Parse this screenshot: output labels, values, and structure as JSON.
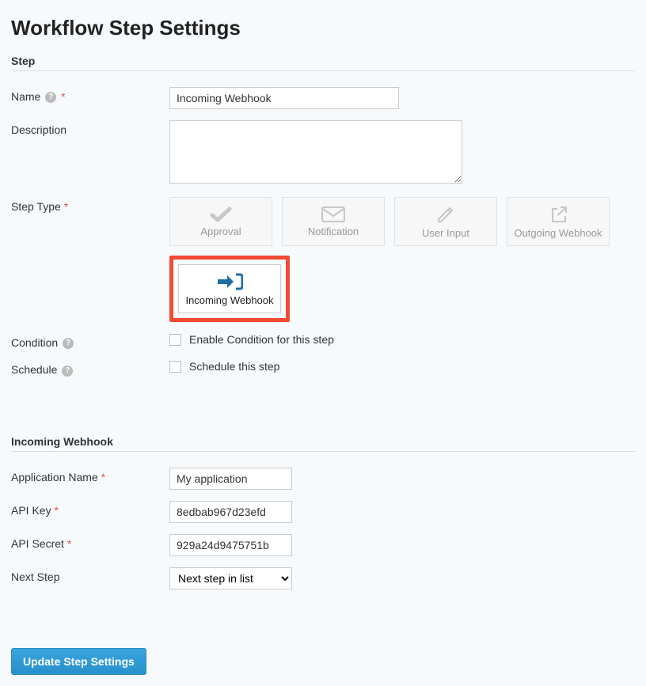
{
  "page_title": "Workflow Step Settings",
  "step_section": {
    "header": "Step",
    "name_label": "Name",
    "name_value": "Incoming Webhook",
    "description_label": "Description",
    "description_value": "",
    "steptype_label": "Step Type",
    "types": [
      {
        "label": "Approval"
      },
      {
        "label": "Notification"
      },
      {
        "label": "User Input"
      },
      {
        "label": "Outgoing Webhook"
      },
      {
        "label": "Incoming Webhook"
      }
    ],
    "condition_label": "Condition",
    "condition_checkbox_label": "Enable Condition for this step",
    "schedule_label": "Schedule",
    "schedule_checkbox_label": "Schedule this step"
  },
  "webhook_section": {
    "header": "Incoming Webhook",
    "app_name_label": "Application Name",
    "app_name_value": "My application",
    "api_key_label": "API Key",
    "api_key_value": "8edbab967d23efd",
    "api_secret_label": "API Secret",
    "api_secret_value": "929a24d9475751b",
    "next_step_label": "Next Step",
    "next_step_value": "Next step in list"
  },
  "submit_button": "Update Step Settings"
}
